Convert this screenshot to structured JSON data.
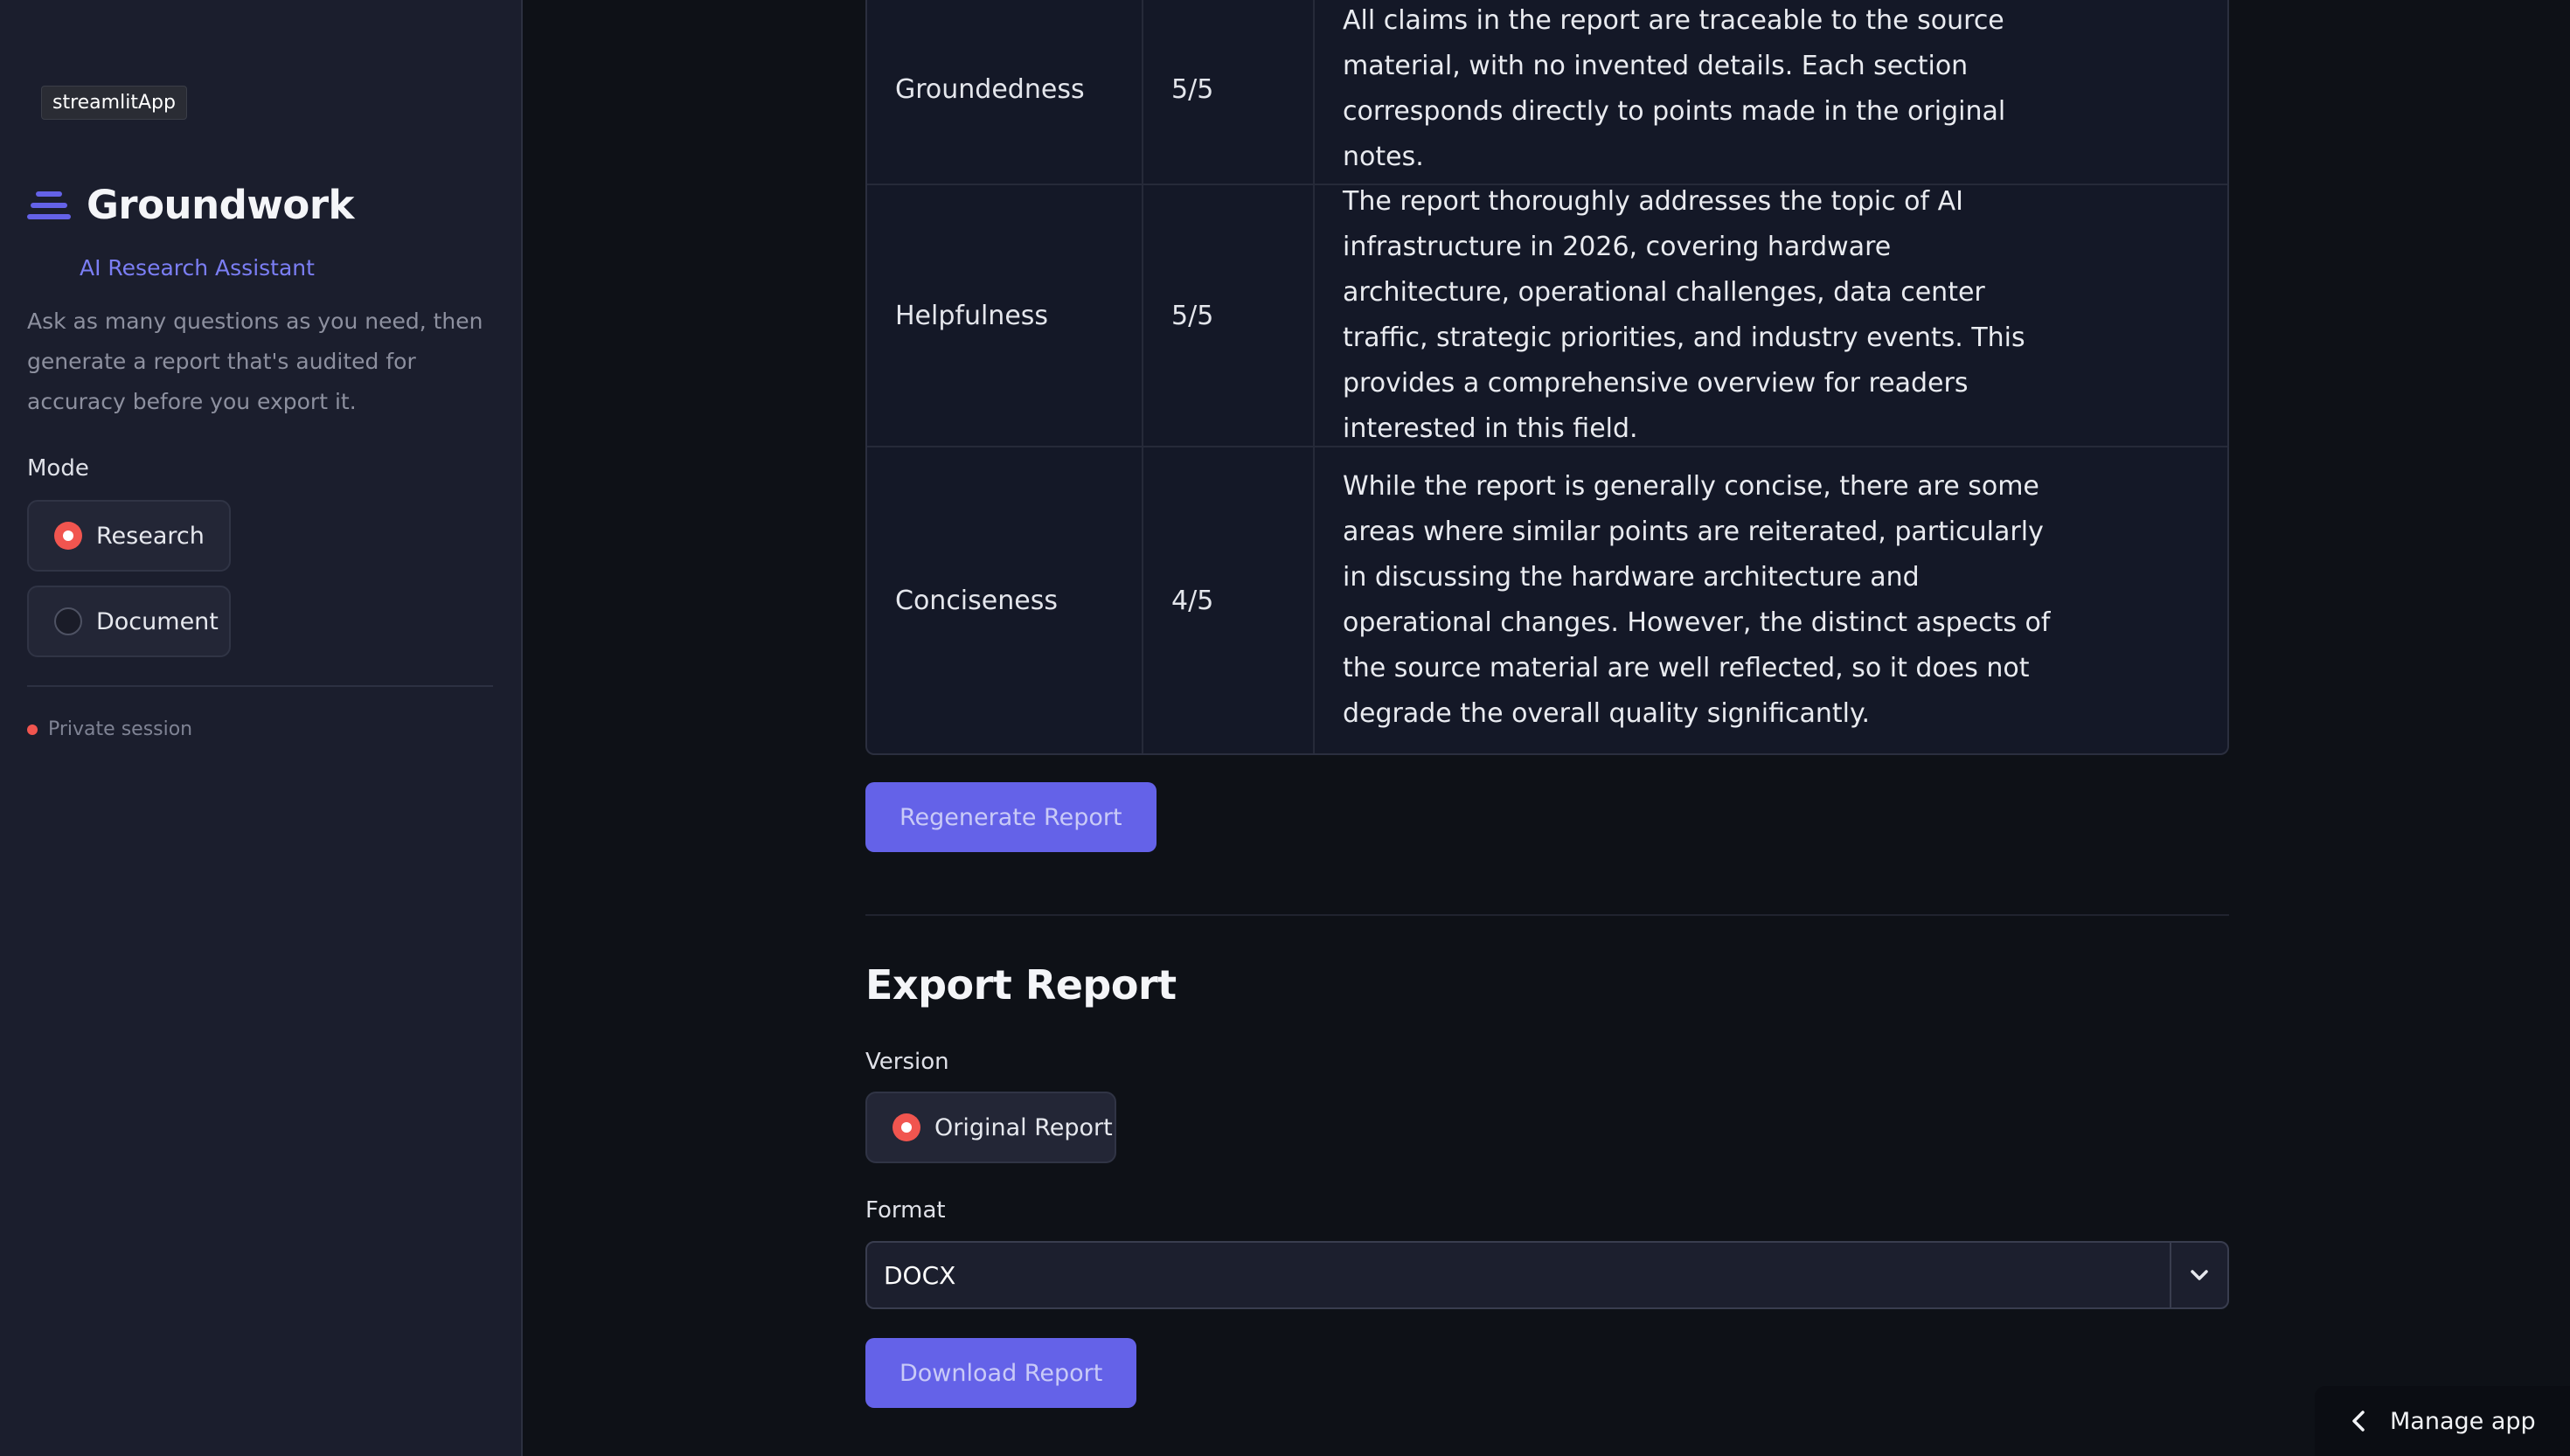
{
  "sidebar": {
    "app_tag": "streamlitApp",
    "brand_title": "Groundwork",
    "brand_subtitle": "AI Research Assistant",
    "description": "Ask as many questions as you need, then generate a report that's audited for accuracy before you export it.",
    "mode_label": "Mode",
    "mode_options": [
      {
        "label": "Research",
        "selected": true
      },
      {
        "label": "Document",
        "selected": false
      }
    ],
    "session_status": "Private session"
  },
  "audit": {
    "rows": [
      {
        "metric": "Groundedness",
        "score": "5/5",
        "comment": "All claims in the report are traceable to the source material, with no invented details. Each section corresponds directly to points made in the original notes."
      },
      {
        "metric": "Helpfulness",
        "score": "5/5",
        "comment": "The report thoroughly addresses the topic of AI infrastructure in 2026, covering hardware architecture, operational challenges, data center traffic, strategic priorities, and industry events. This provides a comprehensive overview for readers interested in this field."
      },
      {
        "metric": "Conciseness",
        "score": "4/5",
        "comment": "While the report is generally concise, there are some areas where similar points are reiterated, particularly in discussing the hardware architecture and operational changes. However, the distinct aspects of the source material are well reflected, so it does not degrade the overall quality significantly."
      }
    ],
    "regenerate_label": "Regenerate Report"
  },
  "export": {
    "title": "Export Report",
    "version_label": "Version",
    "version_option": "Original Report",
    "format_label": "Format",
    "format_value": "DOCX",
    "download_label": "Download Report"
  },
  "footer": {
    "manage_app_label": "Manage app"
  },
  "colors": {
    "accent": "#6462e8",
    "brand": "#7b7ef4",
    "radio_selected": "#f1554f",
    "background": "#0e1117",
    "sidebar": "#1b1e2d"
  }
}
